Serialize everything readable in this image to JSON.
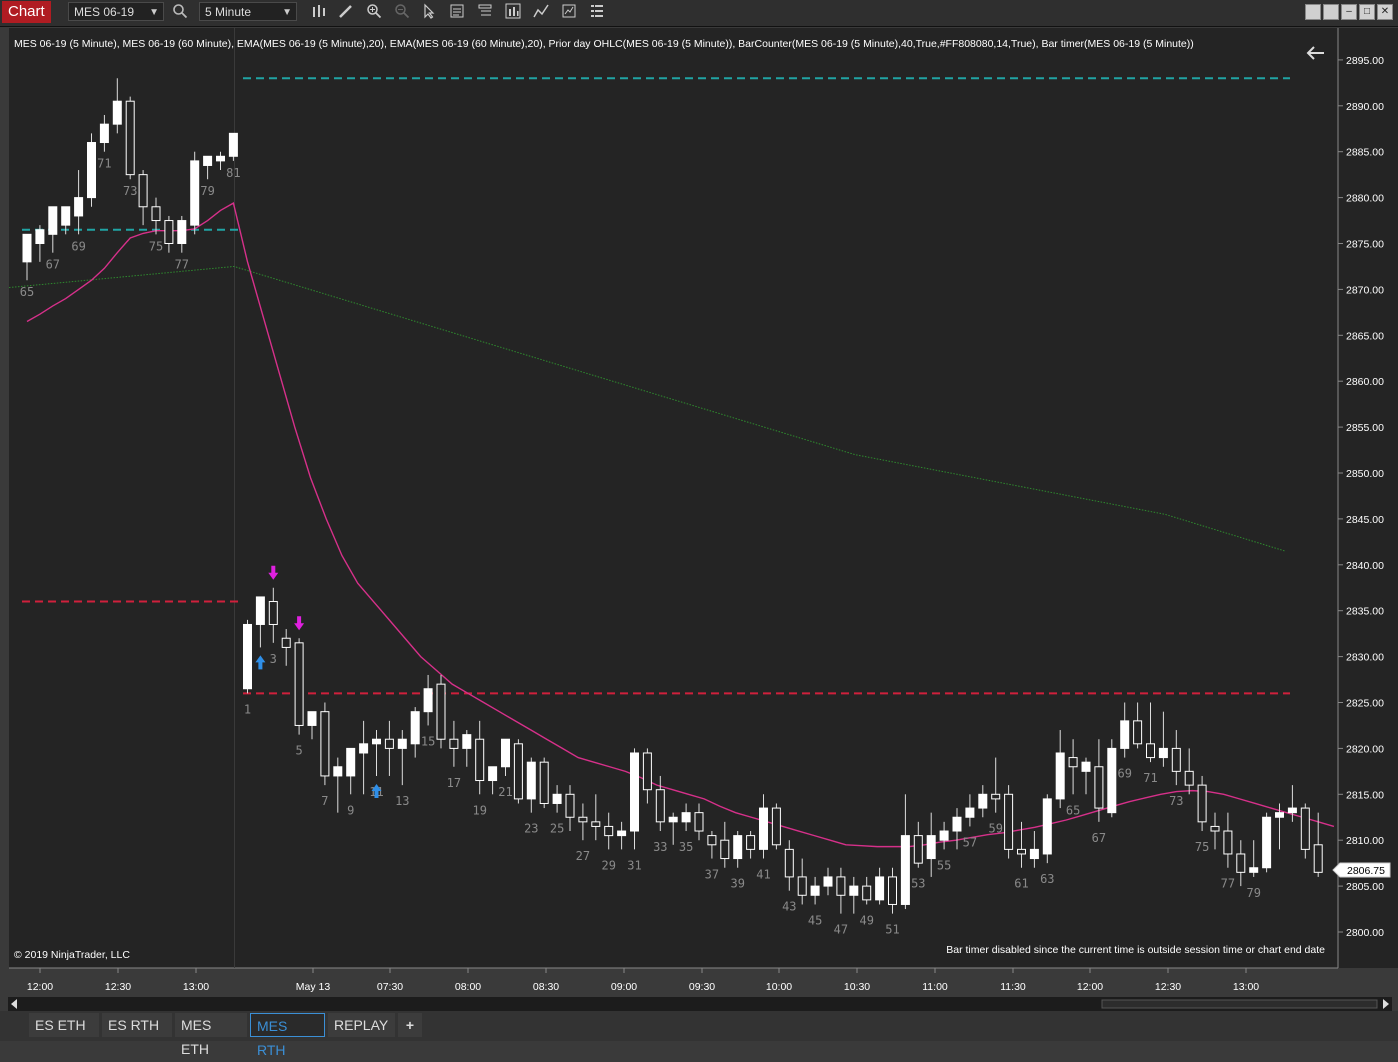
{
  "toolbar": {
    "chart_tab": "Chart",
    "instrument": "MES 06-19",
    "interval": "5 Minute",
    "window_buttons": [
      "",
      "",
      "–",
      "□",
      "✕"
    ]
  },
  "chart": {
    "title": "MES 06-19 (5 Minute), MES 06-19 (60 Minute), EMA(MES 06-19 (5 Minute),20), EMA(MES 06-19 (60 Minute),20), Prior day OHLC(MES 06-19 (5 Minute)), BarCounter(MES 06-19 (5 Minute),40,True,#FF808080,14,True), Bar timer(MES 06-19 (5 Minute))",
    "copyright": "© 2019 NinjaTrader, LLC",
    "bar_timer_msg": "Bar timer disabled since the current time is outside session time or chart end date",
    "price_label": "2806.75"
  },
  "colors": {
    "background": "#242424",
    "candle": "#ffffff",
    "ema5": "#d6308a",
    "ema60": "#2e8a2e",
    "prior_close": "#20a4a4",
    "prior_range": "#d0203c",
    "arrow_up": "#2f8fe8",
    "arrow_down": "#e020e0"
  },
  "chart_data": {
    "type": "candlestick",
    "ylim": [
      2797.5,
      2899
    ],
    "y_ticks": [
      "2895.00",
      "2890.00",
      "2885.00",
      "2880.00",
      "2875.00",
      "2870.00",
      "2865.00",
      "2860.00",
      "2855.00",
      "2850.00",
      "2845.00",
      "2840.00",
      "2835.00",
      "2830.00",
      "2825.00",
      "2820.00",
      "2815.00",
      "2810.00",
      "2805.00",
      "2800.00"
    ],
    "x_ticks": [
      "12:00",
      "12:30",
      "13:00",
      "May 13",
      "07:30",
      "08:00",
      "08:30",
      "09:00",
      "09:30",
      "10:00",
      "10:30",
      "11:00",
      "11:30",
      "12:00",
      "12:30",
      "13:00"
    ],
    "prev_session_candles": [
      {
        "o": 2873,
        "h": 2876,
        "l": 2871,
        "c": 2876
      },
      {
        "o": 2875,
        "h": 2877,
        "l": 2873,
        "c": 2876.5
      },
      {
        "o": 2876,
        "h": 2878,
        "l": 2874,
        "c": 2879
      },
      {
        "o": 2877,
        "h": 2879,
        "l": 2876,
        "c": 2879
      },
      {
        "o": 2878,
        "h": 2883,
        "l": 2876,
        "c": 2880
      },
      {
        "o": 2880,
        "h": 2887,
        "l": 2879,
        "c": 2886
      },
      {
        "o": 2886,
        "h": 2889,
        "l": 2885,
        "c": 2888
      },
      {
        "o": 2888,
        "h": 2893,
        "l": 2887,
        "c": 2890.5
      },
      {
        "o": 2890.5,
        "h": 2891,
        "l": 2882,
        "c": 2882.5
      },
      {
        "o": 2882.5,
        "h": 2883,
        "l": 2877,
        "c": 2879
      },
      {
        "o": 2879,
        "h": 2880,
        "l": 2876,
        "c": 2877.5
      },
      {
        "o": 2877.5,
        "h": 2878,
        "l": 2874,
        "c": 2875
      },
      {
        "o": 2875,
        "h": 2878,
        "l": 2874,
        "c": 2877.5
      },
      {
        "o": 2877,
        "h": 2885,
        "l": 2876,
        "c": 2884
      },
      {
        "o": 2883.5,
        "h": 2884.5,
        "l": 2882,
        "c": 2884.5
      },
      {
        "o": 2884,
        "h": 2885,
        "l": 2883,
        "c": 2884.5
      },
      {
        "o": 2884.5,
        "h": 2887,
        "l": 2884,
        "c": 2887
      }
    ],
    "session_candles": [
      {
        "o": 2826.5,
        "h": 2834,
        "l": 2826,
        "c": 2833.5
      },
      {
        "o": 2833.5,
        "h": 2836.5,
        "l": 2831,
        "c": 2836.5
      },
      {
        "o": 2836,
        "h": 2837.5,
        "l": 2831.5,
        "c": 2833.5
      },
      {
        "o": 2832,
        "h": 2833,
        "l": 2829,
        "c": 2831
      },
      {
        "o": 2831.5,
        "h": 2832,
        "l": 2821.5,
        "c": 2822.5
      },
      {
        "o": 2822.5,
        "h": 2824,
        "l": 2821,
        "c": 2824
      },
      {
        "o": 2824,
        "h": 2825,
        "l": 2816,
        "c": 2817
      },
      {
        "o": 2817,
        "h": 2819,
        "l": 2813,
        "c": 2818
      },
      {
        "o": 2817,
        "h": 2820,
        "l": 2815,
        "c": 2820
      },
      {
        "o": 2819.5,
        "h": 2823,
        "l": 2815,
        "c": 2820.5
      },
      {
        "o": 2820.5,
        "h": 2822,
        "l": 2817,
        "c": 2821
      },
      {
        "o": 2821,
        "h": 2823,
        "l": 2817,
        "c": 2820
      },
      {
        "o": 2820,
        "h": 2822,
        "l": 2816,
        "c": 2821
      },
      {
        "o": 2820.5,
        "h": 2824.5,
        "l": 2819,
        "c": 2824
      },
      {
        "o": 2824,
        "h": 2828,
        "l": 2822.5,
        "c": 2826.5
      },
      {
        "o": 2827,
        "h": 2828,
        "l": 2820,
        "c": 2821
      },
      {
        "o": 2821,
        "h": 2823,
        "l": 2818,
        "c": 2820
      },
      {
        "o": 2820,
        "h": 2822,
        "l": 2818,
        "c": 2821.5
      },
      {
        "o": 2821,
        "h": 2823,
        "l": 2815,
        "c": 2816.5
      },
      {
        "o": 2816.5,
        "h": 2818,
        "l": 2815,
        "c": 2818
      },
      {
        "o": 2818,
        "h": 2821,
        "l": 2817,
        "c": 2821
      },
      {
        "o": 2820.5,
        "h": 2821,
        "l": 2814,
        "c": 2814.5
      },
      {
        "o": 2814.5,
        "h": 2819,
        "l": 2813,
        "c": 2818.5
      },
      {
        "o": 2818.5,
        "h": 2819,
        "l": 2813.5,
        "c": 2814
      },
      {
        "o": 2814,
        "h": 2816,
        "l": 2813,
        "c": 2815
      },
      {
        "o": 2815,
        "h": 2816,
        "l": 2811,
        "c": 2812.5
      },
      {
        "o": 2812.5,
        "h": 2814,
        "l": 2810,
        "c": 2812
      },
      {
        "o": 2812,
        "h": 2815,
        "l": 2810,
        "c": 2811.5
      },
      {
        "o": 2811.5,
        "h": 2813,
        "l": 2809,
        "c": 2810.5
      },
      {
        "o": 2810.5,
        "h": 2812,
        "l": 2809,
        "c": 2811
      },
      {
        "o": 2811,
        "h": 2820,
        "l": 2809,
        "c": 2819.5
      },
      {
        "o": 2819.5,
        "h": 2820,
        "l": 2814,
        "c": 2815.5
      },
      {
        "o": 2815.5,
        "h": 2817,
        "l": 2811,
        "c": 2812
      },
      {
        "o": 2812,
        "h": 2813,
        "l": 2809.5,
        "c": 2812.5
      },
      {
        "o": 2812,
        "h": 2814,
        "l": 2811,
        "c": 2813
      },
      {
        "o": 2813,
        "h": 2814,
        "l": 2810,
        "c": 2811
      },
      {
        "o": 2810.5,
        "h": 2811,
        "l": 2808,
        "c": 2809.5
      },
      {
        "o": 2810,
        "h": 2812,
        "l": 2807,
        "c": 2808
      },
      {
        "o": 2808,
        "h": 2811,
        "l": 2807,
        "c": 2810.5
      },
      {
        "o": 2810.5,
        "h": 2811,
        "l": 2808,
        "c": 2809
      },
      {
        "o": 2809,
        "h": 2815,
        "l": 2808,
        "c": 2813.5
      },
      {
        "o": 2813.5,
        "h": 2814,
        "l": 2809,
        "c": 2809.5
      },
      {
        "o": 2809,
        "h": 2810,
        "l": 2804.5,
        "c": 2806
      },
      {
        "o": 2806,
        "h": 2808,
        "l": 2803,
        "c": 2804
      },
      {
        "o": 2804,
        "h": 2806,
        "l": 2803,
        "c": 2805
      },
      {
        "o": 2805,
        "h": 2807,
        "l": 2804,
        "c": 2806
      },
      {
        "o": 2806,
        "h": 2807,
        "l": 2802,
        "c": 2804
      },
      {
        "o": 2804,
        "h": 2806,
        "l": 2802,
        "c": 2805
      },
      {
        "o": 2805,
        "h": 2806,
        "l": 2803,
        "c": 2803.5
      },
      {
        "o": 2803.5,
        "h": 2807,
        "l": 2803,
        "c": 2806
      },
      {
        "o": 2806,
        "h": 2807,
        "l": 2802,
        "c": 2803
      },
      {
        "o": 2803,
        "h": 2815,
        "l": 2802.5,
        "c": 2810.5
      },
      {
        "o": 2810.5,
        "h": 2812,
        "l": 2807,
        "c": 2807.5
      },
      {
        "o": 2808,
        "h": 2813,
        "l": 2806,
        "c": 2810.5
      },
      {
        "o": 2810,
        "h": 2812,
        "l": 2809,
        "c": 2811
      },
      {
        "o": 2811,
        "h": 2813.5,
        "l": 2809,
        "c": 2812.5
      },
      {
        "o": 2812.5,
        "h": 2815,
        "l": 2811.5,
        "c": 2813.5
      },
      {
        "o": 2813.5,
        "h": 2816,
        "l": 2812.5,
        "c": 2815
      },
      {
        "o": 2815,
        "h": 2819,
        "l": 2813,
        "c": 2814.5
      },
      {
        "o": 2815,
        "h": 2816,
        "l": 2808,
        "c": 2809
      },
      {
        "o": 2809,
        "h": 2812,
        "l": 2807,
        "c": 2808.5
      },
      {
        "o": 2808,
        "h": 2811,
        "l": 2807,
        "c": 2809
      },
      {
        "o": 2808.5,
        "h": 2815,
        "l": 2807.5,
        "c": 2814.5
      },
      {
        "o": 2814.5,
        "h": 2822,
        "l": 2813.5,
        "c": 2819.5
      },
      {
        "o": 2819,
        "h": 2821,
        "l": 2815,
        "c": 2818
      },
      {
        "o": 2817.5,
        "h": 2819,
        "l": 2815,
        "c": 2818.5
      },
      {
        "o": 2818,
        "h": 2821,
        "l": 2812,
        "c": 2813.5
      },
      {
        "o": 2813,
        "h": 2821,
        "l": 2812.5,
        "c": 2820
      },
      {
        "o": 2820,
        "h": 2825,
        "l": 2819,
        "c": 2823
      },
      {
        "o": 2823,
        "h": 2825,
        "l": 2820,
        "c": 2820.5
      },
      {
        "o": 2820.5,
        "h": 2825,
        "l": 2818.5,
        "c": 2819
      },
      {
        "o": 2819,
        "h": 2824,
        "l": 2818,
        "c": 2820
      },
      {
        "o": 2820,
        "h": 2822,
        "l": 2816,
        "c": 2817.5
      },
      {
        "o": 2817.5,
        "h": 2820,
        "l": 2815,
        "c": 2816
      },
      {
        "o": 2816,
        "h": 2817,
        "l": 2811,
        "c": 2812
      },
      {
        "o": 2811.5,
        "h": 2813,
        "l": 2809,
        "c": 2811
      },
      {
        "o": 2811,
        "h": 2813,
        "l": 2807,
        "c": 2808.5
      },
      {
        "o": 2808.5,
        "h": 2810,
        "l": 2805,
        "c": 2806.5
      },
      {
        "o": 2806.5,
        "h": 2810,
        "l": 2806,
        "c": 2807
      },
      {
        "o": 2807,
        "h": 2813,
        "l": 2806.5,
        "c": 2812.5
      },
      {
        "o": 2812.5,
        "h": 2814,
        "l": 2809,
        "c": 2813
      },
      {
        "o": 2813,
        "h": 2816,
        "l": 2812,
        "c": 2813.5
      },
      {
        "o": 2813.5,
        "h": 2814,
        "l": 2808,
        "c": 2809
      },
      {
        "o": 2809.5,
        "h": 2813,
        "l": 2806,
        "c": 2806.5
      }
    ],
    "ema5_prev": [
      2866.5,
      2867.3,
      2868.2,
      2869,
      2870,
      2871,
      2872.3,
      2874,
      2875.6,
      2876.1,
      2876.4,
      2876.4,
      2876.4,
      2876.6,
      2877.5,
      2878.6,
      2879.4
    ],
    "ema5_session": [
      2873,
      2867,
      2861,
      2855,
      2849.5,
      2845,
      2841,
      2838,
      2836,
      2834,
      2832,
      2830,
      2828.5,
      2827,
      2826,
      2825,
      2824,
      2823,
      2822,
      2821,
      2820,
      2819,
      2818.5,
      2818,
      2817.5,
      2816.8,
      2816,
      2815.5,
      2815,
      2814.5,
      2813.7,
      2813,
      2812.5,
      2812,
      2811.5,
      2811,
      2810.5,
      2810,
      2809.5,
      2809.4,
      2809.3,
      2809.3,
      2809.3,
      2809.5,
      2809.8,
      2810,
      2810.3,
      2810.6,
      2810.8,
      2811.1,
      2811.4,
      2811.8,
      2812.2,
      2812.7,
      2813.2,
      2813.7,
      2814.2,
      2814.6,
      2815,
      2815.3,
      2815.4,
      2815.3,
      2815,
      2814.5,
      2814,
      2813.5,
      2813,
      2812.5,
      2812,
      2811.5
    ],
    "ema60": {
      "x_prev_start": 2870.2,
      "x_prev_end": 2872.5,
      "session_start": 2872.5,
      "session_end": 2841.5
    },
    "prior_day_close": 2876.5,
    "prior_day_high": 2893,
    "prior_day_low": 2836,
    "session_low_line": 2826,
    "bar_labels_prev": [
      {
        "i": 0,
        "label": "65"
      },
      {
        "i": 2,
        "label": "67"
      },
      {
        "i": 4,
        "label": "69"
      },
      {
        "i": 6,
        "label": "71"
      },
      {
        "i": 8,
        "label": "73"
      },
      {
        "i": 10,
        "label": "75"
      },
      {
        "i": 12,
        "label": "77"
      },
      {
        "i": 14,
        "label": "79"
      },
      {
        "i": 16,
        "label": "81"
      }
    ],
    "bar_labels_session": [
      "1",
      "3",
      "5",
      "7",
      "9",
      "11",
      "13",
      "15",
      "17",
      "19",
      "21",
      "23",
      "25",
      "27",
      "29",
      "31",
      "33",
      "35",
      "37",
      "39",
      "41",
      "43",
      "45",
      "47",
      "49",
      "51",
      "53",
      "55",
      "57",
      "59",
      "61",
      "63",
      "65",
      "67",
      "69",
      "71",
      "73",
      "75",
      "77",
      "79"
    ],
    "signals": [
      {
        "i": 1,
        "type": "up"
      },
      {
        "i": 2,
        "type": "down"
      },
      {
        "i": 4,
        "type": "down"
      },
      {
        "i": 10,
        "type": "up"
      }
    ]
  },
  "tabs": [
    "ES ETH",
    "ES RTH",
    "MES ETH",
    "MES RTH",
    "REPLAY",
    "+"
  ],
  "active_tab": "MES RTH"
}
